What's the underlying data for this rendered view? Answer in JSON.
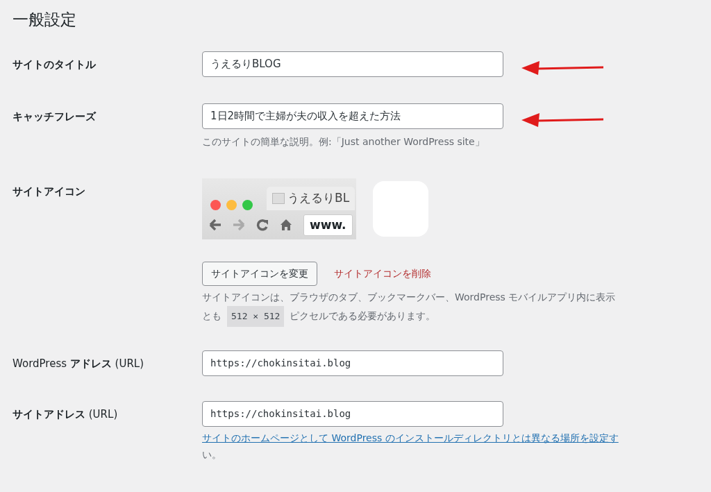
{
  "page_title": "一般設定",
  "fields": [
    {
      "label": "サイトのタイトル",
      "value": "うえるりBLOG",
      "annotated": true
    },
    {
      "label": "キャッチフレーズ",
      "value": "1日2時間で主婦が夫の収入を超えた方法",
      "annotated": true,
      "help": "このサイトの簡単な説明。例:「Just another WordPress site」"
    }
  ],
  "site_icon": {
    "label": "サイトアイコン",
    "preview_tab_title": "うえるりBL",
    "preview_address": "www.",
    "change_button": "サイトアイコンを変更",
    "remove_link": "サイトアイコンを削除",
    "help_line1": "サイトアイコンは、ブラウザのタブ、ブックマークバー、WordPress モバイルアプリ内に表示",
    "help_line2_start": "とも",
    "help_size": "512 × 512",
    "help_line2_end": "ピクセルである必要があります。"
  },
  "urls": [
    {
      "label": "WordPress **アドレス** (URL)",
      "value": "https://chokinsitai.blog"
    },
    {
      "label": "**サイトアドレス** (URL)",
      "value": "https://chokinsitai.blog",
      "help_link": "サイトのホームページとして WordPress のインストールディレクトリとは異なる場所を設定す",
      "help_rest": "い。"
    }
  ]
}
